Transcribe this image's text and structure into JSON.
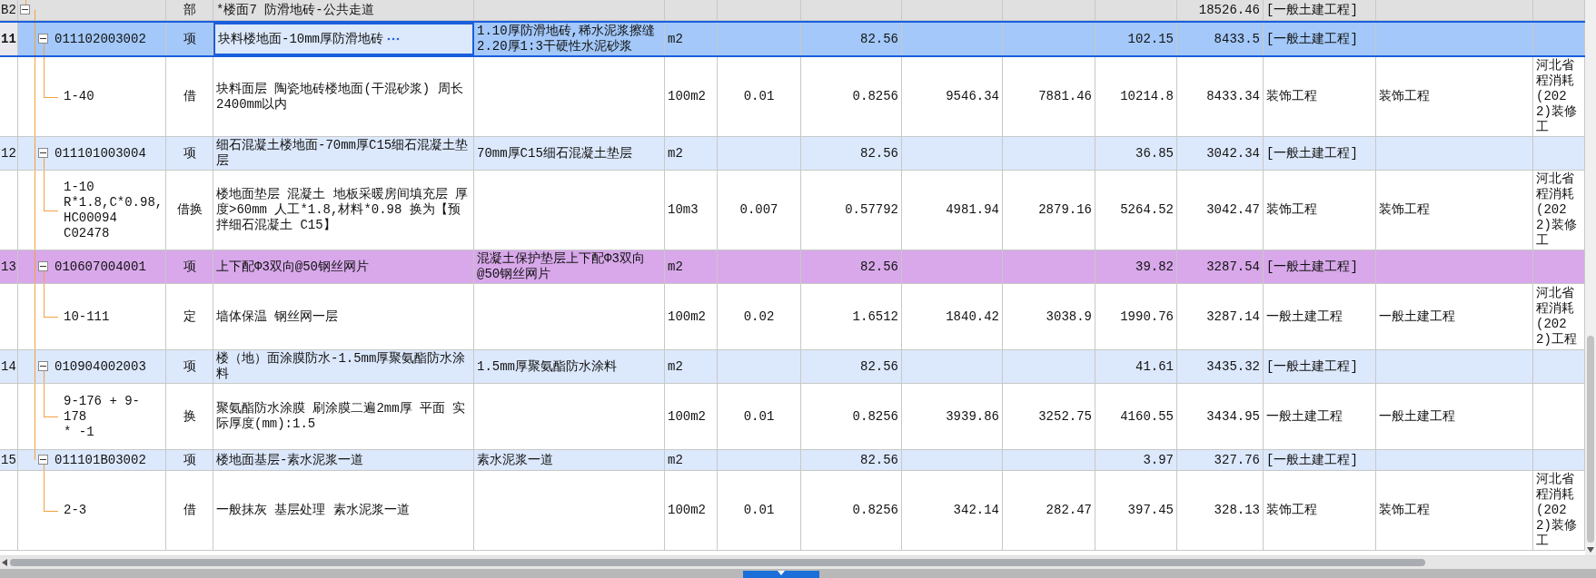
{
  "rows": [
    {
      "kind": "section",
      "expanded": true,
      "selected": false,
      "color": "#e0e0e0",
      "column_1": "B2",
      "column_3": "部",
      "column_4": "*楼面7 防滑地砖-公共走道",
      "column_12": "18526.46",
      "column_13": "[一般土建工程]"
    },
    {
      "kind": "item",
      "expanded": true,
      "selected": true,
      "color": "#dce8fc",
      "column_1": "11",
      "column_2": "011102003002",
      "column_3": "项",
      "column_4": "块料楼地面-10mm厚防滑地砖",
      "column_5": "1.10厚防滑地砖,稀水泥浆擦缝\n2.20厚1:3干硬性水泥砂浆",
      "column_6": "m2",
      "column_8": "82.56",
      "column_11": "102.15",
      "column_12": "8433.5",
      "column_13": "[一般土建工程]"
    },
    {
      "kind": "quota",
      "selected": false,
      "color": "#ffffff",
      "column_2": "1-40",
      "column_3": "借",
      "column_4": "块料面层 陶瓷地砖楼地面(干混砂浆) 周长2400mm以内",
      "column_6": "100m2",
      "column_7": "0.01",
      "column_8": "0.8256",
      "column_9": "9546.34",
      "column_10": "7881.46",
      "column_11": "10214.8",
      "column_12": "8433.34",
      "column_13": "装饰工程",
      "column_14": "装饰工程",
      "column_15": "河北省程消耗(2022)装修工"
    },
    {
      "kind": "item",
      "expanded": true,
      "selected": false,
      "color": "#dce8fc",
      "column_1": "12",
      "column_2": "011101003004",
      "column_3": "项",
      "column_4": "细石混凝土楼地面-70mm厚C15细石混凝土垫层",
      "column_5": "70mm厚C15细石混凝土垫层",
      "column_6": "m2",
      "column_8": "82.56",
      "column_11": "36.85",
      "column_12": "3042.34",
      "column_13": "[一般土建工程]"
    },
    {
      "kind": "quota",
      "selected": false,
      "color": "#ffffff",
      "column_2": "1-10\nR*1.8,C*0.98,\nHC00094\nC02478",
      "column_3": "借换",
      "column_4": "楼地面垫层 混凝土  地板采暖房间填充层 厚度>60mm 人工*1.8,材料*0.98  换为【预拌细石混凝土 C15】",
      "column_6": "10m3",
      "column_7": "0.007",
      "column_8": "0.57792",
      "column_9": "4981.94",
      "column_10": "2879.16",
      "column_11": "5264.52",
      "column_12": "3042.47",
      "column_13": "装饰工程",
      "column_14": "装饰工程",
      "column_15": "河北省程消耗(2022)装修工"
    },
    {
      "kind": "item",
      "expanded": true,
      "selected": false,
      "color": "#d8a8ea",
      "column_1": "13",
      "column_2": "010607004001",
      "column_3": "项",
      "column_4": "上下配Φ3双向@50钢丝网片",
      "column_5": "混凝土保护垫层上下配Φ3双向@50钢丝网片",
      "column_6": "m2",
      "column_8": "82.56",
      "column_11": "39.82",
      "column_12": "3287.54",
      "column_13": "[一般土建工程]"
    },
    {
      "kind": "quota",
      "selected": false,
      "color": "#ffffff",
      "column_2": "10-111",
      "column_3": "定",
      "column_4": "墙体保温 钢丝网一层",
      "column_6": "100m2",
      "column_7": "0.02",
      "column_8": "1.6512",
      "column_9": "1840.42",
      "column_10": "3038.9",
      "column_11": "1990.76",
      "column_12": "3287.14",
      "column_13": "一般土建工程",
      "column_14": "一般土建工程",
      "column_15": "河北省程消耗(2022)工程"
    },
    {
      "kind": "item",
      "expanded": true,
      "selected": false,
      "color": "#dce8fc",
      "column_1": "14",
      "column_2": "010904002003",
      "column_3": "项",
      "column_4": "楼（地）面涂膜防水-1.5mm厚聚氨酯防水涂料",
      "column_5": "1.5mm厚聚氨酯防水涂料",
      "column_6": "m2",
      "column_8": "82.56",
      "column_11": "41.61",
      "column_12": "3435.32",
      "column_13": "[一般土建工程]"
    },
    {
      "kind": "quota",
      "selected": false,
      "color": "#ffffff",
      "column_2": "9-176 + 9-178\n* -1",
      "column_3": "换",
      "column_4": "聚氨酯防水涂膜 刷涂膜二遍2mm厚 平面 实际厚度(mm):1.5",
      "column_6": "100m2",
      "column_7": "0.01",
      "column_8": "0.8256",
      "column_9": "3939.86",
      "column_10": "3252.75",
      "column_11": "4160.55",
      "column_12": "3434.95",
      "column_13": "一般土建工程",
      "column_14": "一般土建工程"
    },
    {
      "kind": "item",
      "expanded": true,
      "selected": false,
      "color": "#dce8fc",
      "column_1": "15",
      "column_2": "011101B03002",
      "column_3": "项",
      "column_4": "楼地面基层-素水泥浆一道",
      "column_5": "素水泥浆一道",
      "column_6": "m2",
      "column_8": "82.56",
      "column_11": "3.97",
      "column_12": "327.76",
      "column_13": "[一般土建工程]"
    },
    {
      "kind": "quota",
      "selected": false,
      "color": "#ffffff",
      "column_2": "2-3",
      "column_3": "借",
      "column_4": "一般抹灰 基层处理 素水泥浆一道",
      "column_6": "100m2",
      "column_7": "0.01",
      "column_8": "0.8256",
      "column_9": "342.14",
      "column_10": "282.47",
      "column_11": "397.45",
      "column_12": "328.13",
      "column_13": "装饰工程",
      "column_14": "装饰工程",
      "column_15": "河北省程消耗(2022)装修工"
    }
  ]
}
